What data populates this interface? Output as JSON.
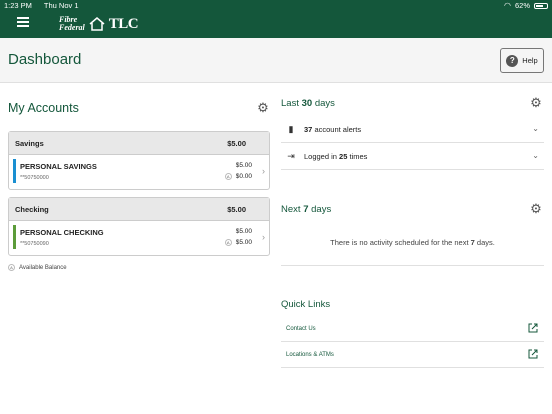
{
  "status": {
    "time": "1:23 PM",
    "date": "Thu Nov 1",
    "battery": "62%"
  },
  "header": {
    "logo_line1": "Fibre",
    "logo_line2": "Federal",
    "logo_tlc": "TLC"
  },
  "page": {
    "title": "Dashboard",
    "help_label": "Help"
  },
  "accounts": {
    "title": "My Accounts",
    "groups": [
      {
        "name": "Savings",
        "total": "$5.00",
        "accounts": [
          {
            "name": "PERSONAL SAVINGS",
            "number": "**50750000",
            "current": "$5.00",
            "available": "$0.00",
            "color": "#1a8fd1"
          }
        ]
      },
      {
        "name": "Checking",
        "total": "$5.00",
        "accounts": [
          {
            "name": "PERSONAL CHECKING",
            "number": "**50750090",
            "current": "$5.00",
            "available": "$5.00",
            "color": "#5c9c3a"
          }
        ]
      }
    ],
    "available_legend": "Available Balance",
    "available_icon": "A"
  },
  "last_days": {
    "prefix": "Last",
    "days": "30",
    "suffix": "days",
    "alerts_count": "37",
    "alerts_label": "account alerts",
    "logins_prefix": "Logged in",
    "logins_count": "25",
    "logins_suffix": "times"
  },
  "next_days": {
    "prefix": "Next",
    "days": "7",
    "suffix": "days",
    "message_prefix": "There is no activity scheduled for the next",
    "message_days": "7",
    "message_suffix": "days."
  },
  "quick_links": {
    "title": "Quick Links",
    "items": [
      {
        "label": "Contact Us"
      },
      {
        "label": "Locations & ATMs"
      }
    ]
  },
  "colors": {
    "brand": "#14573b",
    "savings_bar": "#1a8fd1",
    "checking_bar": "#5c9c3a"
  }
}
